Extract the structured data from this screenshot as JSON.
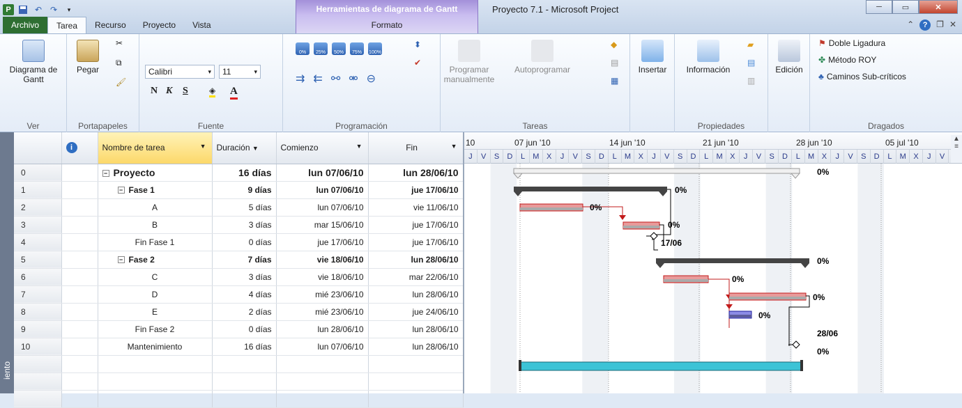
{
  "titlebar": {
    "context_tab_title": "Herramientas de diagrama de Gantt",
    "window_title": "Proyecto 7.1 - Microsoft Project",
    "context_tab_label": "Formato"
  },
  "tabs": [
    "Archivo",
    "Tarea",
    "Recurso",
    "Proyecto",
    "Vista"
  ],
  "ribbon": {
    "ver": {
      "button": "Diagrama de Gantt",
      "label": "Ver"
    },
    "portapapeles": {
      "paste": "Pegar",
      "label": "Portapapeles"
    },
    "fuente": {
      "font": "Calibri",
      "size": "11",
      "bold": "N",
      "italic": "K",
      "underline": "S",
      "label": "Fuente"
    },
    "programacion": {
      "percents": [
        "0%",
        "25%",
        "50%",
        "75%",
        "100%"
      ],
      "label": "Programación"
    },
    "tareas": {
      "manual": "Programar manualmente",
      "auto": "Autoprogramar",
      "label": "Tareas"
    },
    "insertar": {
      "button": "Insertar"
    },
    "propiedades": {
      "button": "Información",
      "label": "Propiedades"
    },
    "edicion": {
      "button": "Edición"
    },
    "dragados": {
      "items": [
        "Doble Ligadura",
        "Método ROY",
        "Caminos Sub-críticos"
      ],
      "label": "Dragados"
    }
  },
  "table": {
    "headers": {
      "info": "i",
      "name": "Nombre de tarea",
      "duration": "Duración",
      "start": "Comienzo",
      "end": "Fin"
    },
    "rows": [
      {
        "id": "0",
        "name": "Proyecto",
        "duration": "16 días",
        "start": "lun 07/06/10",
        "end": "lun 28/06/10"
      },
      {
        "id": "1",
        "name": "Fase 1",
        "duration": "9 días",
        "start": "lun 07/06/10",
        "end": "jue 17/06/10"
      },
      {
        "id": "2",
        "name": "A",
        "duration": "5 días",
        "start": "lun 07/06/10",
        "end": "vie 11/06/10"
      },
      {
        "id": "3",
        "name": "B",
        "duration": "3 días",
        "start": "mar 15/06/10",
        "end": "jue 17/06/10"
      },
      {
        "id": "4",
        "name": "Fin Fase 1",
        "duration": "0 días",
        "start": "jue 17/06/10",
        "end": "jue 17/06/10"
      },
      {
        "id": "5",
        "name": "Fase 2",
        "duration": "7 días",
        "start": "vie 18/06/10",
        "end": "lun 28/06/10"
      },
      {
        "id": "6",
        "name": "C",
        "duration": "3 días",
        "start": "vie 18/06/10",
        "end": "mar 22/06/10"
      },
      {
        "id": "7",
        "name": "D",
        "duration": "4 días",
        "start": "mié 23/06/10",
        "end": "lun 28/06/10"
      },
      {
        "id": "8",
        "name": "E",
        "duration": "2 días",
        "start": "mié 23/06/10",
        "end": "jue 24/06/10"
      },
      {
        "id": "9",
        "name": "Fin Fase 2",
        "duration": "0 días",
        "start": "lun 28/06/10",
        "end": "lun 28/06/10"
      },
      {
        "id": "10",
        "name": "Mantenimiento",
        "duration": "16 días",
        "start": "lun 07/06/10",
        "end": "lun 28/06/10"
      }
    ]
  },
  "gantt": {
    "partial_week": "10",
    "weeks": [
      "07 jun '10",
      "14 jun '10",
      "21 jun '10",
      "28 jun '10",
      "05 jul '10"
    ],
    "days": [
      "J",
      "V",
      "S",
      "D",
      "L",
      "M",
      "X",
      "J",
      "V",
      "S",
      "D",
      "L",
      "M",
      "X",
      "J",
      "V",
      "S",
      "D",
      "L",
      "M",
      "X",
      "J",
      "V",
      "S",
      "D",
      "L",
      "M",
      "X",
      "J",
      "V",
      "S",
      "D",
      "L",
      "M",
      "X",
      "J",
      "V"
    ],
    "labels": {
      "r0": "0%",
      "r1": "0%",
      "r2": "0%",
      "r3": "0%",
      "r4": "17/06",
      "r5": "0%",
      "r6": "0%",
      "r7": "0%",
      "r8": "0%",
      "r9": "28/06",
      "r10": "0%"
    }
  },
  "viewbar": {
    "label": "iento"
  }
}
